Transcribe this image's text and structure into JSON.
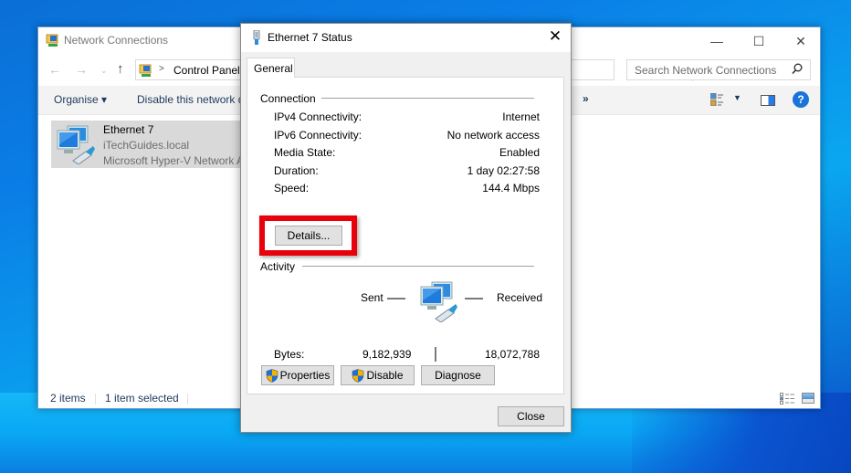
{
  "explorer": {
    "title": "Network Connections",
    "address": {
      "separator": ">",
      "path": "Control Panel"
    },
    "search_placeholder": "Search Network Connections",
    "window_controls": {
      "minimize": "—",
      "maximize": "☐",
      "close": "✕"
    },
    "nav": {
      "back": "←",
      "forward": "→",
      "recent": "⌄",
      "up": "↑",
      "dropdown": "⌄",
      "refresh": "↻"
    },
    "commands": {
      "organise": "Organise ▾",
      "disable": "Disable this network device",
      "more": "»",
      "view_dropdown": "▼",
      "help": "?"
    },
    "connection": {
      "name": "Ethernet 7",
      "domain": "iTechGuides.local",
      "adapter": "Microsoft Hyper-V Network Adapter"
    },
    "status": {
      "items": "2 items",
      "selected": "1 item selected"
    }
  },
  "dialog": {
    "title": "Ethernet 7 Status",
    "close_glyph": "✕",
    "tab": "General",
    "connection": {
      "label": "Connection",
      "rows": [
        {
          "label": "IPv4 Connectivity:",
          "value": "Internet"
        },
        {
          "label": "IPv6 Connectivity:",
          "value": "No network access"
        },
        {
          "label": "Media State:",
          "value": "Enabled"
        },
        {
          "label": "Duration:",
          "value": "1 day 02:27:58"
        },
        {
          "label": "Speed:",
          "value": "144.4 Mbps"
        }
      ],
      "details_button": "Details..."
    },
    "activity": {
      "label": "Activity",
      "sent_label": "Sent",
      "received_label": "Received",
      "bytes_label": "Bytes:",
      "bytes_sent": "9,182,939",
      "bytes_received": "18,072,788"
    },
    "buttons": {
      "properties": "Properties",
      "disable": "Disable",
      "diagnose": "Diagnose",
      "close": "Close"
    },
    "highlight_color": "#e8000b"
  }
}
